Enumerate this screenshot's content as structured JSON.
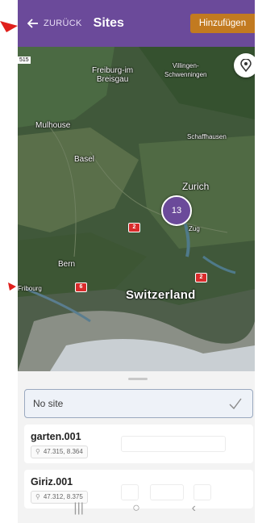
{
  "header": {
    "back_label": "ZURÜCK",
    "title": "Sites",
    "add_label": "Hinzufügen"
  },
  "map": {
    "scale_tag": "515",
    "cities": {
      "freiburg": "Freiburg-im\nBreisgau",
      "villingen": "Villingen-\nSchwenningen",
      "mulhouse": "Mulhouse",
      "basel": "Basel",
      "schaffhausen": "Schaffhausen",
      "zurich": "Zurich",
      "zug": "Zug",
      "bern": "Bern",
      "fribourg": "Fribourg",
      "switzerland": "Switzerland"
    },
    "road_badges": {
      "a": "2",
      "b": "2",
      "c": "6",
      "d": "2"
    },
    "cluster_count": "13"
  },
  "sheet": {
    "no_site_label": "No site",
    "sites": [
      {
        "name": "garten.001",
        "coords": "47.315, 8.364"
      },
      {
        "name": "Giriz.001",
        "coords": "47.312, 8.375"
      }
    ]
  },
  "colors": {
    "header": "#6b4a9a",
    "add_button": "#c27a20",
    "cluster": "#6b4a9a",
    "annotation": "#e0201c"
  },
  "icons": {
    "back": "arrow-left-icon",
    "location": "location-pin-icon",
    "check": "check-icon",
    "coord_pin": "pin-icon",
    "nav_recent": "recent-apps-icon",
    "nav_home": "home-icon",
    "nav_back": "back-chevron-icon"
  }
}
